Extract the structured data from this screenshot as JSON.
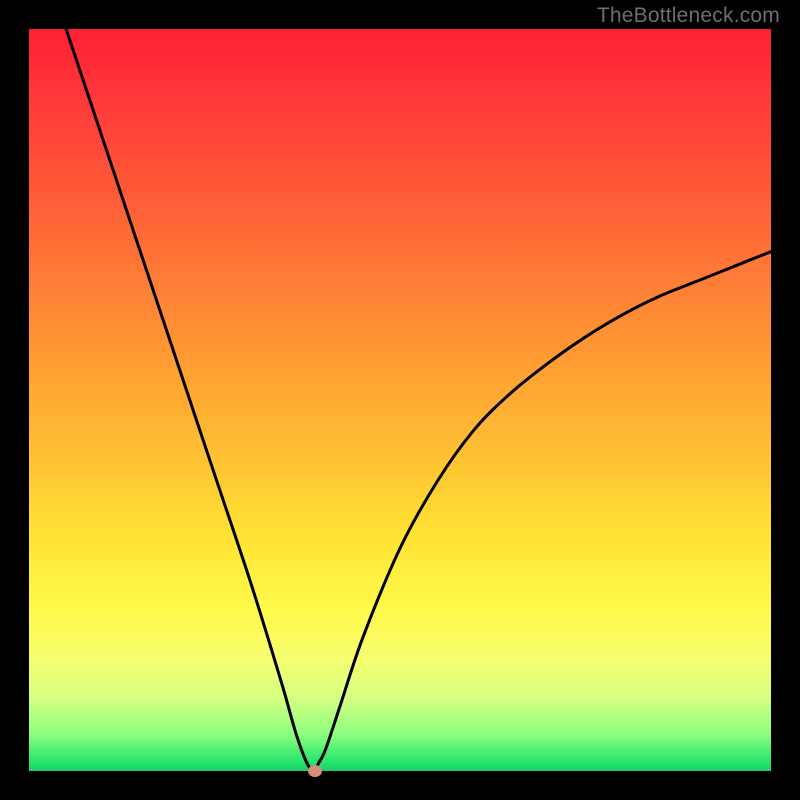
{
  "watermark": "TheBottleneck.com",
  "chart_data": {
    "type": "line",
    "title": "",
    "xlabel": "",
    "ylabel": "",
    "xlim": [
      0,
      100
    ],
    "ylim": [
      0,
      100
    ],
    "grid": false,
    "background_gradient": {
      "orientation": "vertical",
      "stops": [
        {
          "pos": 0.0,
          "color": "#ff1f33"
        },
        {
          "pos": 0.5,
          "color": "#ffc233"
        },
        {
          "pos": 0.8,
          "color": "#fff94a"
        },
        {
          "pos": 1.0,
          "color": "#1fc96a"
        }
      ]
    },
    "series": [
      {
        "name": "bottleneck-curve",
        "x": [
          5,
          10,
          15,
          20,
          25,
          30,
          34,
          36,
          37.5,
          38.5,
          39,
          40,
          42,
          45,
          50,
          55,
          60,
          65,
          70,
          75,
          80,
          85,
          90,
          95,
          100
        ],
        "y": [
          100,
          85,
          70,
          55,
          40,
          25,
          12,
          5,
          1,
          0,
          1,
          3,
          9,
          18,
          30,
          39,
          46,
          51,
          55,
          58.5,
          61.5,
          64,
          66,
          68,
          70
        ]
      }
    ],
    "marker": {
      "name": "optimal-point",
      "x": 38.5,
      "y": 0,
      "color": "#d68d7a"
    }
  }
}
